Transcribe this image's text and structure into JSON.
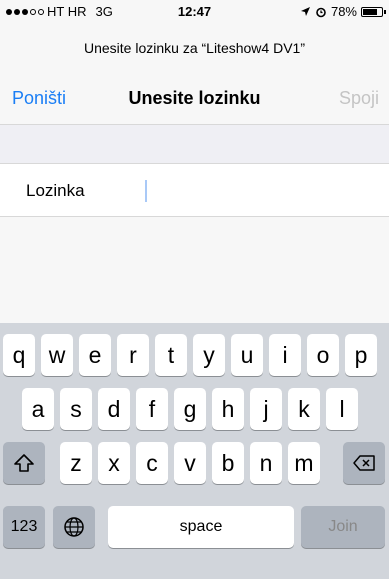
{
  "status": {
    "carrier": "HT HR",
    "network": "3G",
    "time": "12:47",
    "battery": "78%",
    "signal_dots_filled": 3,
    "signal_dots_total": 5
  },
  "prompt": "Unesite lozinku za “Liteshow4 DV1”",
  "navbar": {
    "cancel": "Poništi",
    "title": "Unesite lozinku",
    "connect": "Spoji"
  },
  "field": {
    "label": "Lozinka",
    "value": ""
  },
  "keyboard": {
    "row1": [
      "q",
      "w",
      "e",
      "r",
      "t",
      "y",
      "u",
      "i",
      "o",
      "p"
    ],
    "row2": [
      "a",
      "s",
      "d",
      "f",
      "g",
      "h",
      "j",
      "k",
      "l"
    ],
    "row3": [
      "z",
      "x",
      "c",
      "v",
      "b",
      "n",
      "m"
    ],
    "numbers": "123",
    "space": "space",
    "join": "Join"
  },
  "colors": {
    "accent": "#1a7ef5",
    "disabled": "#c4c4c4",
    "keyboard_bg": "#d1d5db"
  }
}
